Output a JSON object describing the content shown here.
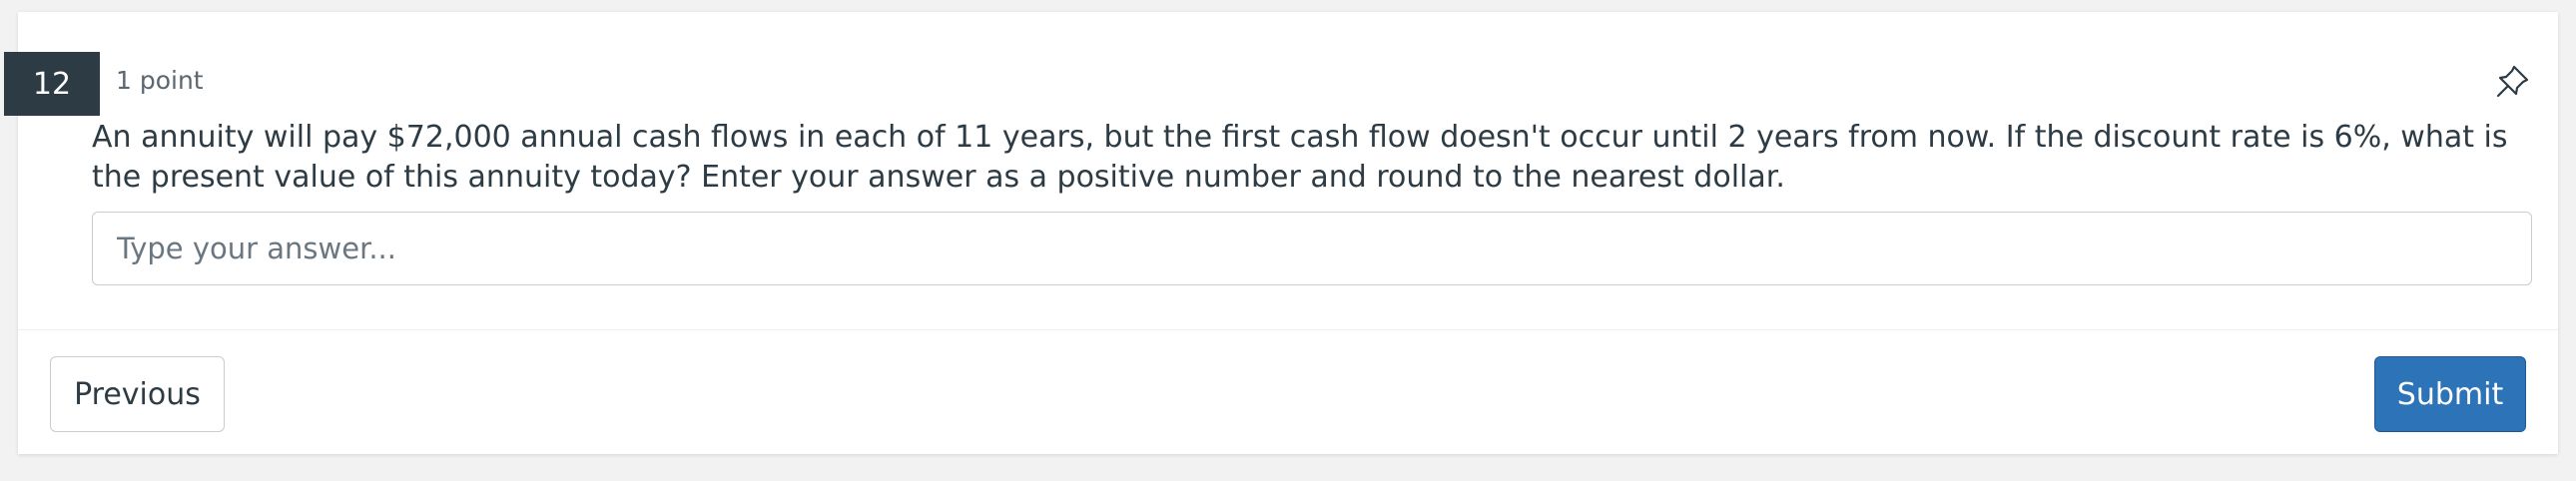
{
  "question": {
    "number": "12",
    "points": "1 point",
    "text": "An annuity will pay $72,000 annual cash flows in each of 11 years, but the first cash flow doesn't occur until 2 years from now. If the discount rate is 6%, what is the present value of this annuity today? Enter your answer as a positive number and round to the nearest dollar.",
    "pin_icon": "pin-icon"
  },
  "answer": {
    "placeholder": "Type your answer...",
    "value": ""
  },
  "footer": {
    "previous_label": "Previous",
    "submit_label": "Submit"
  },
  "colors": {
    "badge": "#2d3b45",
    "submit": "#2d73b7",
    "text": "#2d3b45"
  }
}
